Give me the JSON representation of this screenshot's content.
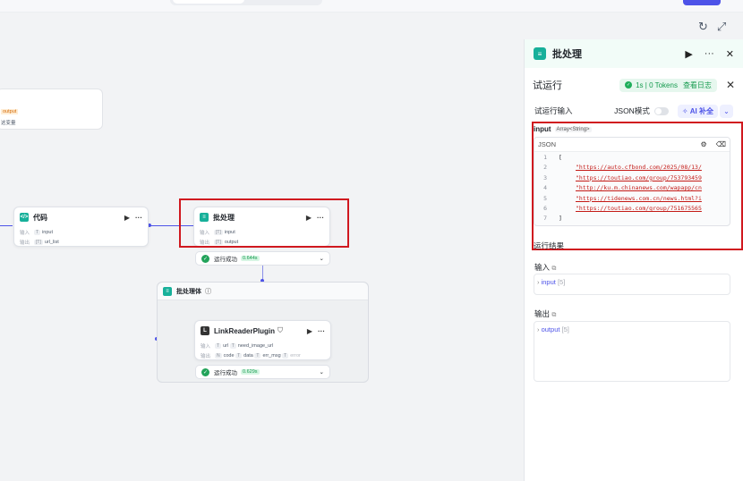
{
  "toolbar": {
    "refresh_icon": "refresh-icon",
    "fullscreen_icon": "expand-icon"
  },
  "partial_node": {
    "output_tag": "output",
    "var_text": "这变量"
  },
  "code_node": {
    "title": "代码",
    "in_label": "输入",
    "in_value": "input",
    "out_label": "输出",
    "out_value": "url_list"
  },
  "batch_node": {
    "title": "批处理",
    "in_label": "输入",
    "in_value": "input",
    "out_label": "输出",
    "out_value": "output",
    "status": "运行成功",
    "time": "0.644s"
  },
  "group": {
    "title": "批处理体"
  },
  "plugin_node": {
    "title": "LinkReaderPlugin",
    "in_label": "输入",
    "in_values": [
      "url",
      "need_image_url"
    ],
    "out_label": "输出",
    "out_values": [
      "code",
      "data",
      "err_msg",
      "error"
    ],
    "status": "运行成功",
    "time": "0.629s"
  },
  "panel": {
    "title": "批处理",
    "subtitle": "",
    "test_title": "试运行",
    "badge": {
      "time": "1s",
      "tokens": "0 Tokens",
      "sep": "|",
      "log": "查看日志"
    },
    "test_input_label": "试运行输入",
    "json_mode_label": "JSON模式",
    "ai_label": "AI 补全",
    "input_name": "input",
    "input_type": "Array<String>",
    "editor_label": "JSON",
    "code_lines": [
      {
        "n": "1",
        "t": "[",
        "s": false
      },
      {
        "n": "2",
        "t": "\"https://auto.cfbond.com/2025/08/13/",
        "s": true
      },
      {
        "n": "3",
        "t": "\"https://toutiao.com/group/753793459",
        "s": true
      },
      {
        "n": "4",
        "t": "\"http://ku.m.chinanews.com/wapapp/cn",
        "s": true
      },
      {
        "n": "5",
        "t": "\"https://tidenews.com.cn/news.html?i",
        "s": true
      },
      {
        "n": "6",
        "t": "\"https://toutiao.com/group/751675565",
        "s": true
      },
      {
        "n": "7",
        "t": "]",
        "s": false
      }
    ],
    "result_label": "运行结果",
    "input_section": "输入",
    "input_item": "input",
    "input_count": "[5]",
    "output_section": "输出",
    "output_item": "output",
    "output_count": "[5]"
  }
}
